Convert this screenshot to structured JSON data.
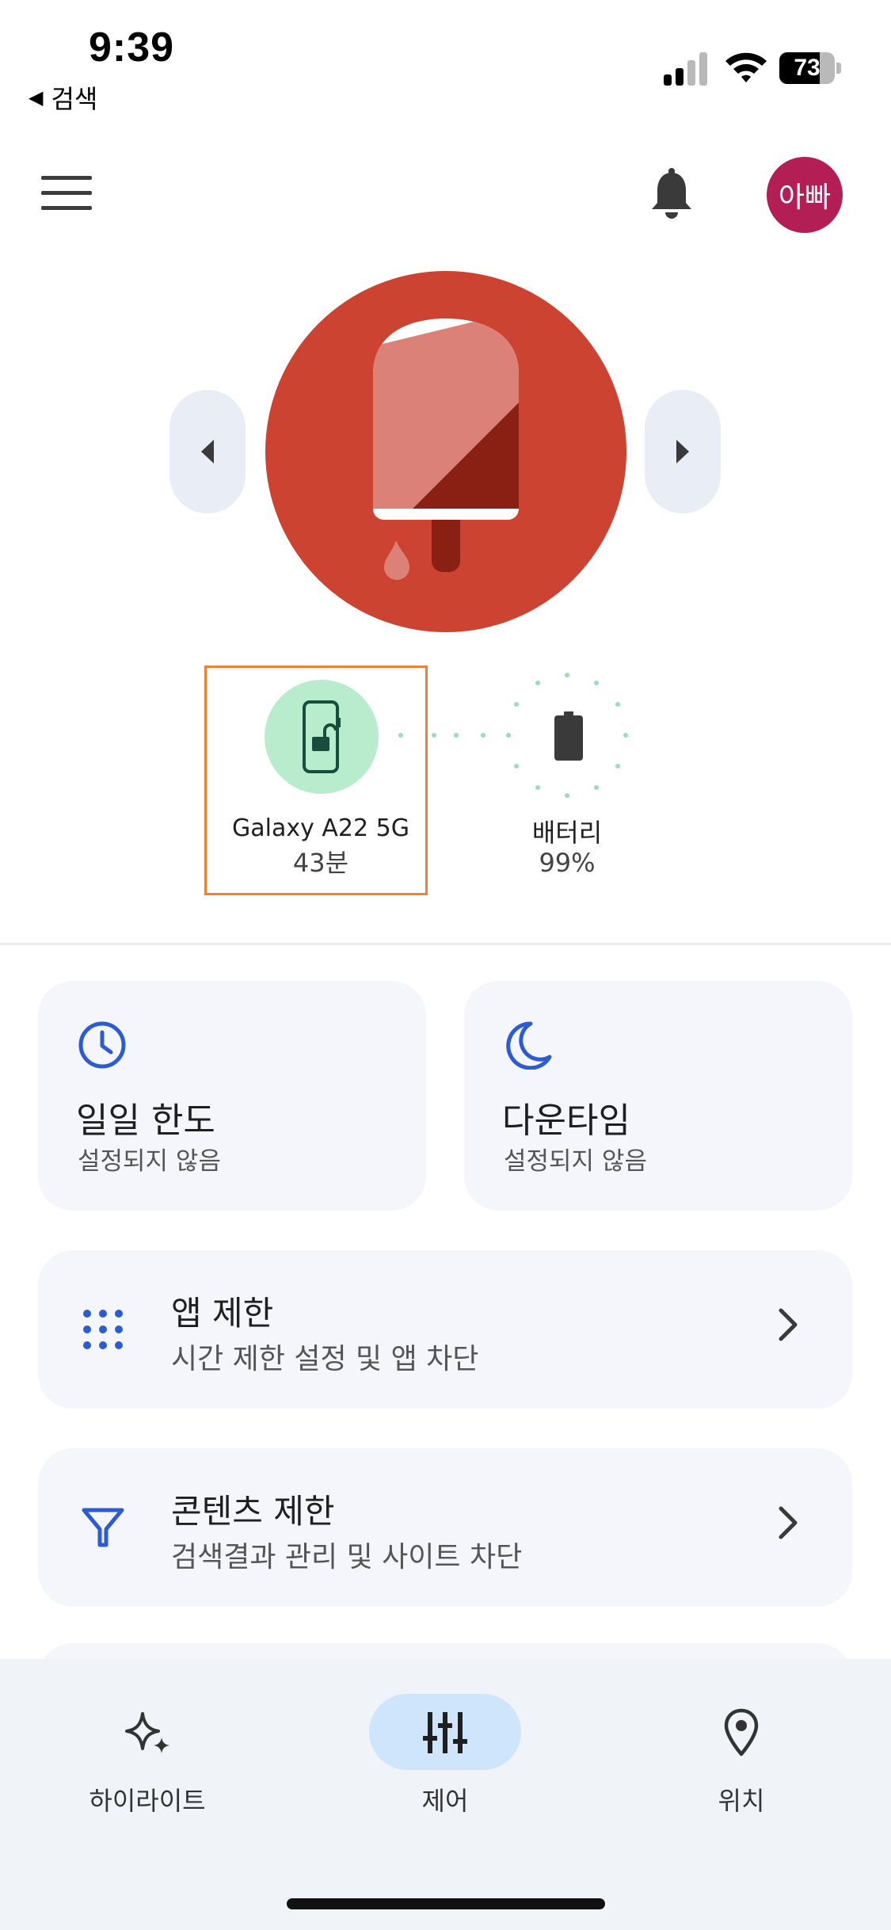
{
  "status_bar": {
    "time": "9:39",
    "back_label": "검색",
    "battery_level": "73"
  },
  "app_bar": {
    "avatar_text": "아빠"
  },
  "devices": {
    "phone": {
      "name": "Galaxy A22 5G",
      "time": "43분"
    },
    "battery": {
      "label": "배터리",
      "value": "99%"
    }
  },
  "cards": {
    "daily_limit": {
      "title": "일일 한도",
      "subtitle": "설정되지 않음"
    },
    "downtime": {
      "title": "다운타임",
      "subtitle": "설정되지 않음"
    }
  },
  "rows": {
    "app_limits": {
      "title": "앱 제한",
      "subtitle": "시간 제한 설정 및 앱 차단"
    },
    "content_limits": {
      "title": "콘텐츠 제한",
      "subtitle": "검색결과 관리 및 사이트 차단"
    }
  },
  "bottom_nav": {
    "highlights": "하이라이트",
    "control": "제어",
    "location": "위치"
  },
  "colors": {
    "accent_blue": "#2d5bd0",
    "hero_red": "#cc4331",
    "avatar": "#b31f55",
    "device_green": "#b9ebcd",
    "selection_orange": "#f08133"
  }
}
